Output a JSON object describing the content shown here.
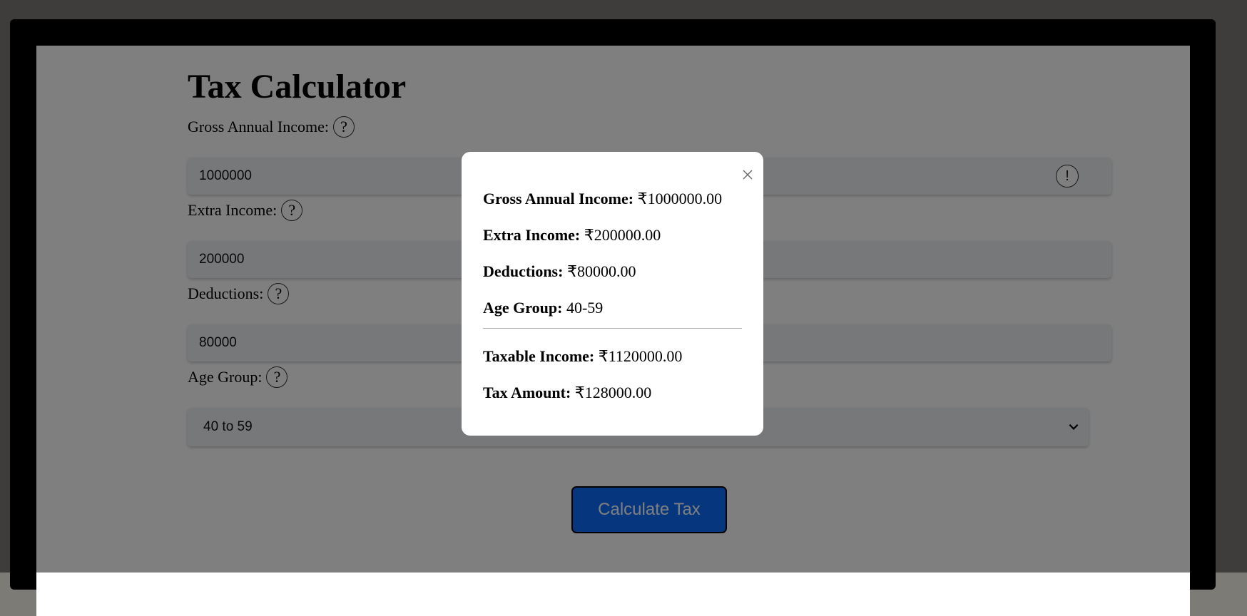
{
  "page": {
    "title": "Tax Calculator"
  },
  "form": {
    "gross": {
      "label": "Gross Annual Income:",
      "help": "?",
      "value": "1000000",
      "alert": "!"
    },
    "extra": {
      "label": "Extra Income:",
      "help": "?",
      "value": "200000"
    },
    "deductions": {
      "label": "Deductions:",
      "help": "?",
      "value": "80000"
    },
    "age": {
      "label": "Age Group:",
      "help": "?",
      "selected": "40 to 59"
    },
    "submit_label": "Calculate Tax"
  },
  "modal": {
    "gross_label": "Gross Annual Income:",
    "gross_value": "₹1000000.00",
    "extra_label": "Extra Income:",
    "extra_value": "₹200000.00",
    "deductions_label": "Deductions:",
    "deductions_value": "₹80000.00",
    "age_label": "Age Group:",
    "age_value": "40-59",
    "taxable_label": "Taxable Income:",
    "taxable_value": "₹1120000.00",
    "tax_label": "Tax Amount:",
    "tax_value": "₹128000.00"
  },
  "colors": {
    "button": "#0d6efd",
    "overlay": "rgba(0,0,0,0.5)"
  }
}
